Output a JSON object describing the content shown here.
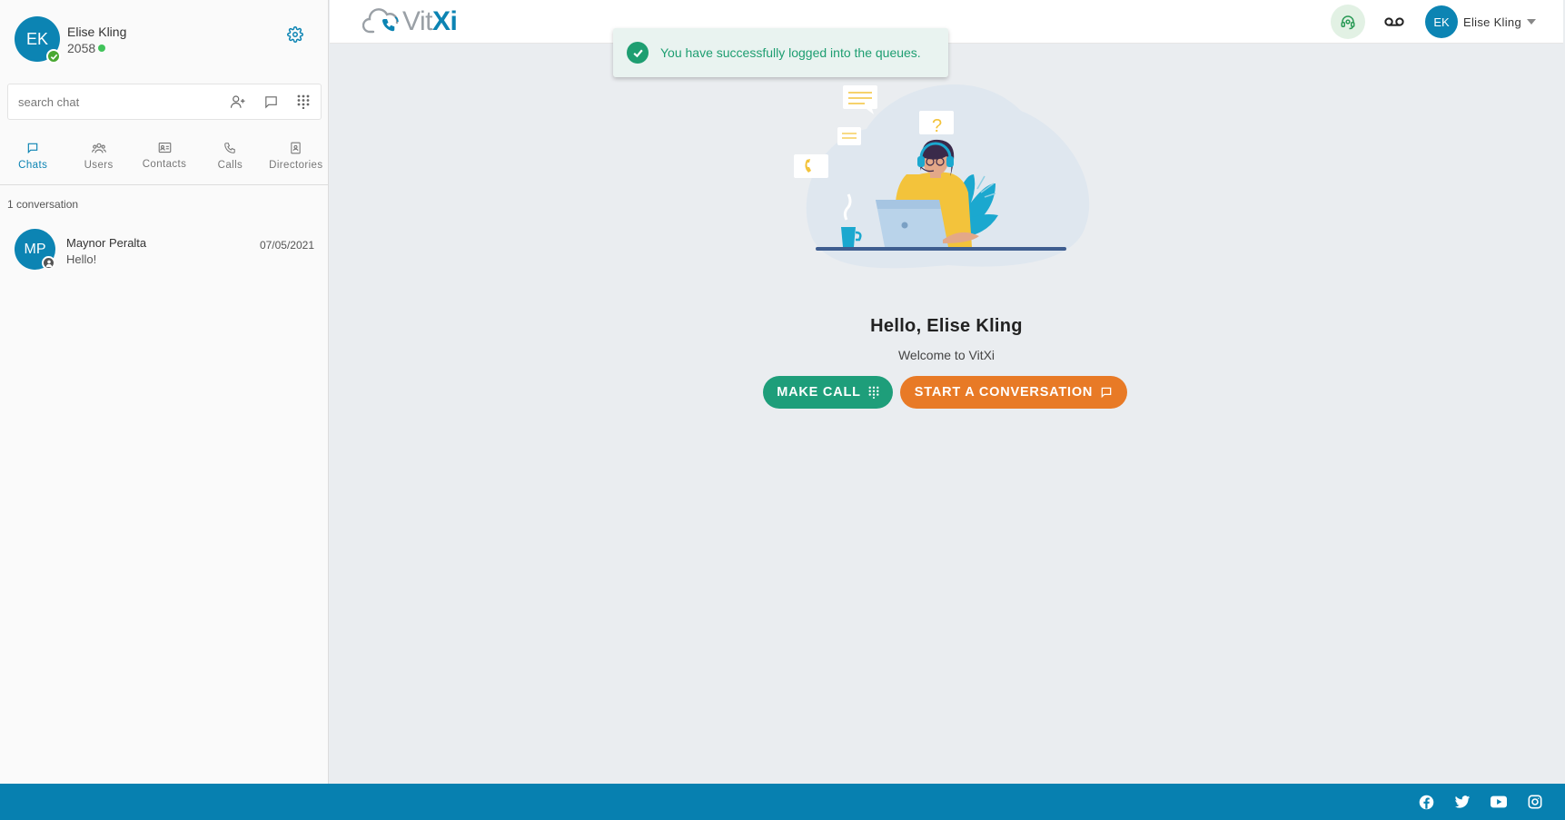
{
  "profile": {
    "initials": "EK",
    "name": "Elise Kling",
    "extension": "2058"
  },
  "search": {
    "placeholder": "search chat"
  },
  "tabs": [
    {
      "label": "Chats",
      "icon": "chat-icon",
      "active": true
    },
    {
      "label": "Users",
      "icon": "users-icon",
      "active": false
    },
    {
      "label": "Contacts",
      "icon": "contacts-icon",
      "active": false
    },
    {
      "label": "Calls",
      "icon": "phone-icon",
      "active": false
    },
    {
      "label": "Directories",
      "icon": "directory-icon",
      "active": false
    }
  ],
  "conversations": {
    "count_label": "1 conversation",
    "items": [
      {
        "initials": "MP",
        "name": "Maynor Peralta",
        "message": "Hello!",
        "date": "07/05/2021"
      }
    ]
  },
  "topbar": {
    "logo_part1": "Vit",
    "logo_part2": "Xi",
    "user_initials": "EK",
    "user_name": "Elise Kling"
  },
  "toast": {
    "message": "You have successfully logged into the queues."
  },
  "main": {
    "greeting": "Hello, Elise Kling",
    "welcome": "Welcome to VitXi",
    "make_call_label": "MAKE CALL",
    "start_conversation_label": "START A CONVERSATION"
  },
  "colors": {
    "brand": "#0c84b3",
    "success": "#1e9e71",
    "make_call": "#1e9e7a",
    "start_conversation": "#e87a26",
    "footer": "#0780b0"
  },
  "footer": {
    "socials": [
      "facebook-icon",
      "twitter-icon",
      "youtube-icon",
      "instagram-icon"
    ]
  }
}
